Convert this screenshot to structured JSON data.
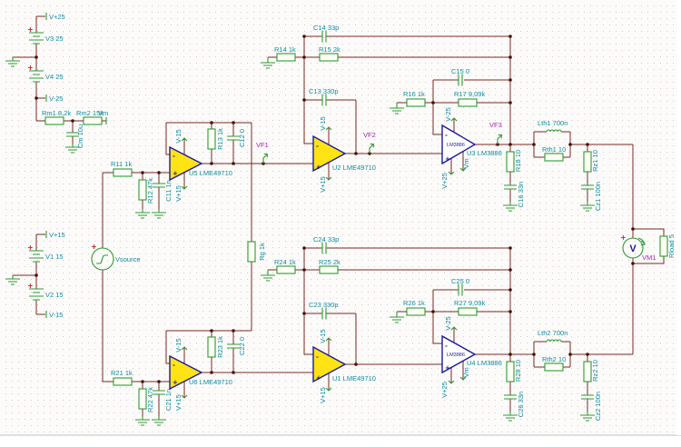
{
  "app": {
    "view": "circuit-schematic-canvas"
  },
  "colors": {
    "wire": "#7a2822",
    "junction": "#45100a",
    "component_green": "#2e9b33",
    "label_teal": "#0d8c9e",
    "testpoint_purple": "#aa22aa",
    "opamp_yellow": "#ffe312",
    "opamp_navy": "#1a1a99",
    "lm3886_fill": "#ffffff",
    "plus_red": "#cc2020",
    "background": "#fcfbfa",
    "grid_dot": "#d9c9c7"
  },
  "labels": {
    "v3": "V3 25",
    "v4": "V4 25",
    "v1": "V1 15",
    "v2": "V2 15",
    "vp25": "V+25",
    "vm25": "V-25",
    "vp15": "V+15",
    "vm15": "V-15",
    "vm": "Vm",
    "rm1": "Rm1 8,2k",
    "rm2": "Rm2 15k",
    "cm": "Cm 10u",
    "vsource": "Vsource",
    "rg": "Rg 1k",
    "r11": "R11 1k",
    "r12": "R12 47k",
    "c11": "C11 1n",
    "r13": "R13 1k",
    "c12": "C12 0",
    "u5": "U5 LME49710",
    "r21": "R21 1k",
    "r22": "R22 47k",
    "c21": "C21 1n",
    "r23": "R23 1k",
    "c22": "C22 0",
    "u6": "U6 LME49710",
    "r14": "R14 1k",
    "r15": "R15 2k",
    "c14": "C14 33p",
    "c13": "C13 330p",
    "u2": "U2 LME49710",
    "r24": "R24 1k",
    "r25": "R25 2k",
    "c24": "C24 33p",
    "c23": "C23 330p",
    "u1": "U1 LME49710",
    "r16": "R16 1k",
    "r17": "R17 9,09k",
    "c15": "C15 0",
    "u3": "U3 LM3886",
    "r26": "R26 1k",
    "r27": "R27 9,09k",
    "c25": "C25 0",
    "u4": "U4 LM3886",
    "chip": "LM3886",
    "r18": "R18 10",
    "c16": "C16 33n",
    "lth1": "Lth1 700n",
    "rth1": "Rth1 10",
    "rz1": "Rz1 10",
    "cz1": "Cz1 100n",
    "r28": "R28 10",
    "c26": "C26 33n",
    "lth2": "Lth2 700n",
    "rth2": "Rth2 10",
    "rz2": "Rz2 10",
    "cz2": "Cz2 100n",
    "vf1": "VF1",
    "vf2": "VF2",
    "vf3": "VF3",
    "vm1": "VM1",
    "rload": "Rload 5",
    "plus_sign": "+",
    "minus_sign": "-",
    "volt_glyph": "V"
  }
}
